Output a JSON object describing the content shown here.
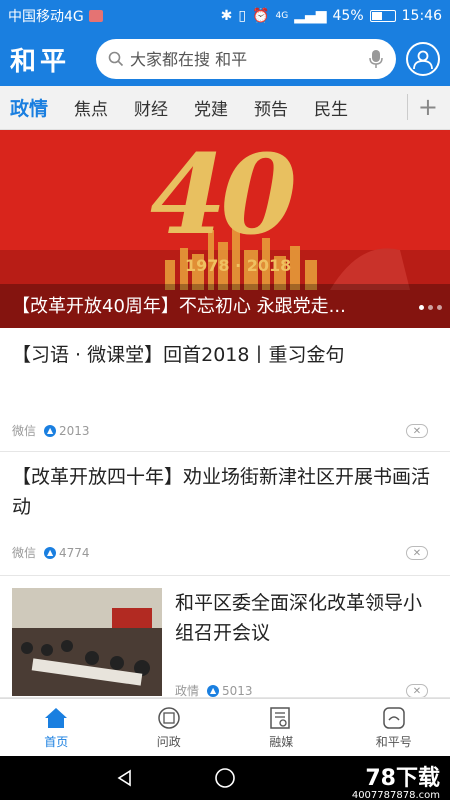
{
  "status_bar": {
    "carrier": "中国移动4G",
    "signal": "4G",
    "battery": "45%",
    "time": "15:46"
  },
  "header": {
    "logo": "和平",
    "search_placeholder": "大家都在搜 和平"
  },
  "tabs": [
    {
      "label": "政情",
      "active": true
    },
    {
      "label": "焦点"
    },
    {
      "label": "财经"
    },
    {
      "label": "党建"
    },
    {
      "label": "预告"
    },
    {
      "label": "民生"
    }
  ],
  "tab_add": "+",
  "banner": {
    "big_text": "40",
    "years": "1978 · 2018",
    "caption": "【改革开放40周年】不忘初心 永跟党走..."
  },
  "news": [
    {
      "title": "【习语 · 微课堂】回首2018丨重习金句",
      "source": "微信",
      "likes": "2013"
    },
    {
      "title": "【改革开放四十年】劝业场街新津社区开展书画活动",
      "source": "微信",
      "likes": "4774"
    },
    {
      "title": "和平区委全面深化改革领导小组召开会议",
      "source": "政情",
      "likes": "5013"
    }
  ],
  "close_symbol": "✕",
  "bottom_nav": [
    {
      "label": "首页",
      "icon": "home-icon",
      "active": true
    },
    {
      "label": "问政",
      "icon": "ask-icon"
    },
    {
      "label": "融媒",
      "icon": "media-icon"
    },
    {
      "label": "和平号",
      "icon": "heping-icon"
    }
  ],
  "watermark": {
    "main": "78下载",
    "sub": "4007787878.com"
  },
  "colors": {
    "brand": "#1a7fe0",
    "banner_red": "#d9251c",
    "gold": "#e8c060"
  }
}
